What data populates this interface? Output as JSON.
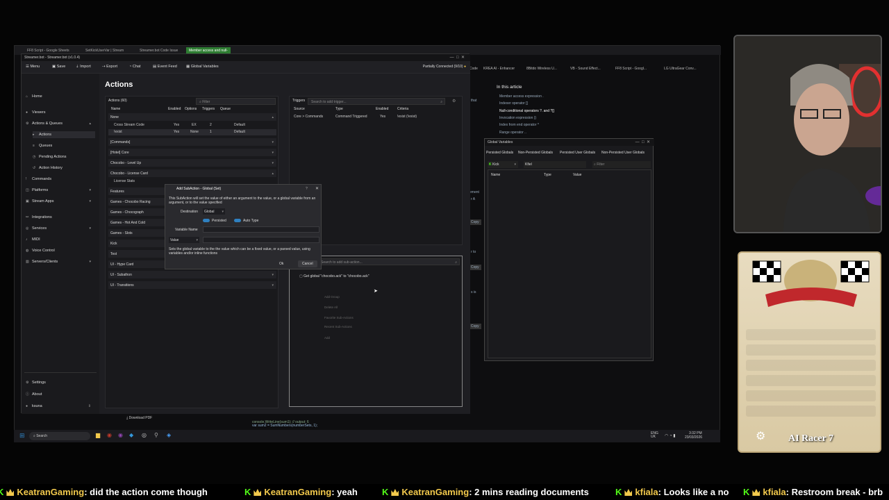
{
  "browser": {
    "tabs": [
      "FF8 Script - Google Sheets",
      "SetKickUserVar | Stream",
      "Streamer.bot Code Issue",
      "Member access and null-"
    ],
    "bookmarks": [
      "Code",
      "KREA AI - Enhancer",
      "8Bitdo Wireless U...",
      "VB - Sound Effect...",
      "FF8 Script - Googl...",
      "LG UltraGear Conv..."
    ]
  },
  "article": {
    "heading": "In this article",
    "items": [
      "Member access expression .",
      "Indexer operator []",
      "Null-conditional operators ?. and ?[]",
      "Invocation expression ()",
      "Index from end operator ^",
      "Range operator .."
    ],
    "fragments": [
      "that",
      "ement",
      "r A",
      "s is",
      "r to"
    ],
    "copy_labels": [
      "Copy",
      "Copy",
      "Copy"
    ]
  },
  "sb": {
    "title": "Streamer.bot - Streamer.bot (v1.0.4)",
    "toolbar": {
      "menu": "Menu",
      "save": "Save",
      "import": "Import",
      "export": "Export",
      "chat": "Chat",
      "event_feed": "Event Feed",
      "global_vars": "Global Variables"
    },
    "status": "Partially Connected (9/10)",
    "nav": {
      "home": "Home",
      "viewers": "Viewers",
      "actions_queues": "Actions & Queues",
      "actions": "Actions",
      "queues": "Queues",
      "pending": "Pending Actions",
      "history": "Action History",
      "commands": "Commands",
      "platforms": "Platforms",
      "stream_apps": "Stream Apps",
      "integrations": "Integrations",
      "services": "Services",
      "midi": "MIDI",
      "voice": "Voice Control",
      "servers": "Servers/Clients",
      "settings": "Settings",
      "about": "About",
      "user": "ksuna"
    },
    "page_title": "Actions",
    "actions_panel": {
      "label": "Actions (60)",
      "filter": "Filter",
      "cols": [
        "Name",
        "Enabled",
        "Options",
        "Triggers",
        "Queue"
      ],
      "groups": [
        "None",
        "[Commands]",
        "[Hotel] Core",
        "Chocobo - Level Up",
        "Chocobo - License Card",
        "Features",
        "Games - Chocobo Racing",
        "Games - Chocograph",
        "Games - Hot And Cold",
        "Games - Slots",
        "Kick",
        "Test",
        "UI - Hype Card",
        "UI - Subathon",
        "UI - Transitions"
      ],
      "rows": [
        {
          "name": "Cross Stream Code",
          "enabled": "Yes",
          "options": "EX",
          "triggers": "2",
          "queue": "Default"
        },
        {
          "name": "!exist",
          "enabled": "Yes",
          "options": "None",
          "triggers": "1",
          "queue": "Default"
        }
      ],
      "license_sub": "License Stats"
    },
    "triggers_panel": {
      "label": "Triggers",
      "search": "Search to add trigger...",
      "cols": [
        "Source",
        "Type",
        "Enabled",
        "Criteria"
      ],
      "row": {
        "source": "Core > Commands",
        "type": "Command Triggered",
        "enabled": "Yes",
        "criteria": "!exist (!exist)"
      }
    },
    "subactions_panel": {
      "search": "Search to add sub-action...",
      "item": "Get global \"chocobo.ack\" to \"chocobo.ack\"",
      "context": [
        "Add Group",
        "Delete All",
        "Favorite Sub-Actions",
        "Recent Sub-Actions",
        "Add"
      ]
    },
    "download": "Download PDF"
  },
  "dialog": {
    "title": "Add SubAction - Global (Set)",
    "desc": "This SubAction will set the value of either an argument to the value, or a global variable from an argument, or to the value specified",
    "destination_label": "Destination",
    "destination_value": "Global",
    "persisted": "Persisted",
    "auto_type": "Auto Type",
    "variable_name": "Variable Name",
    "value_label": "Value",
    "help": "Sets the global variable to the the value which can be a fixed value, or a parsed value, using variables and/or inline functions",
    "ok": "Ok",
    "cancel": "Cancel"
  },
  "global_vars": {
    "title": "Global Variables",
    "tabs": [
      "Persisted Globals",
      "Non-Persisted Globals",
      "Persisted User Globals",
      "Non-Persisted User Globals"
    ],
    "platform": "Kick",
    "user_filter": "Kfiel",
    "filter": "Filter",
    "cols": [
      "Name",
      "Type",
      "Value"
    ]
  },
  "code": {
    "line1": "console.WriteLine(sum1); // output: 6",
    "line2": "var sum2 = SumNumbers(numberSets, 1);"
  },
  "taskbar": {
    "search": "Search",
    "lang": "ENG\nUK",
    "time": "3:32 PM",
    "date": "23/03/2026"
  },
  "card": {
    "title": "AI Racer 7"
  },
  "ticker": [
    {
      "user": "KeatranGaming",
      "msg": ": did the action come though"
    },
    {
      "user": "KeatranGaming",
      "msg": ": yeah"
    },
    {
      "user": "KeatranGaming",
      "msg": ": 2 mins reading documents"
    },
    {
      "user": "kfiala",
      "msg": ": Looks like a no"
    },
    {
      "user": "kfiala",
      "msg": ": Restroom break - brb"
    }
  ],
  "colors": {
    "accent": "#2f80c0",
    "kick": "#53fc18",
    "ticker_user": "#f2c94c"
  }
}
